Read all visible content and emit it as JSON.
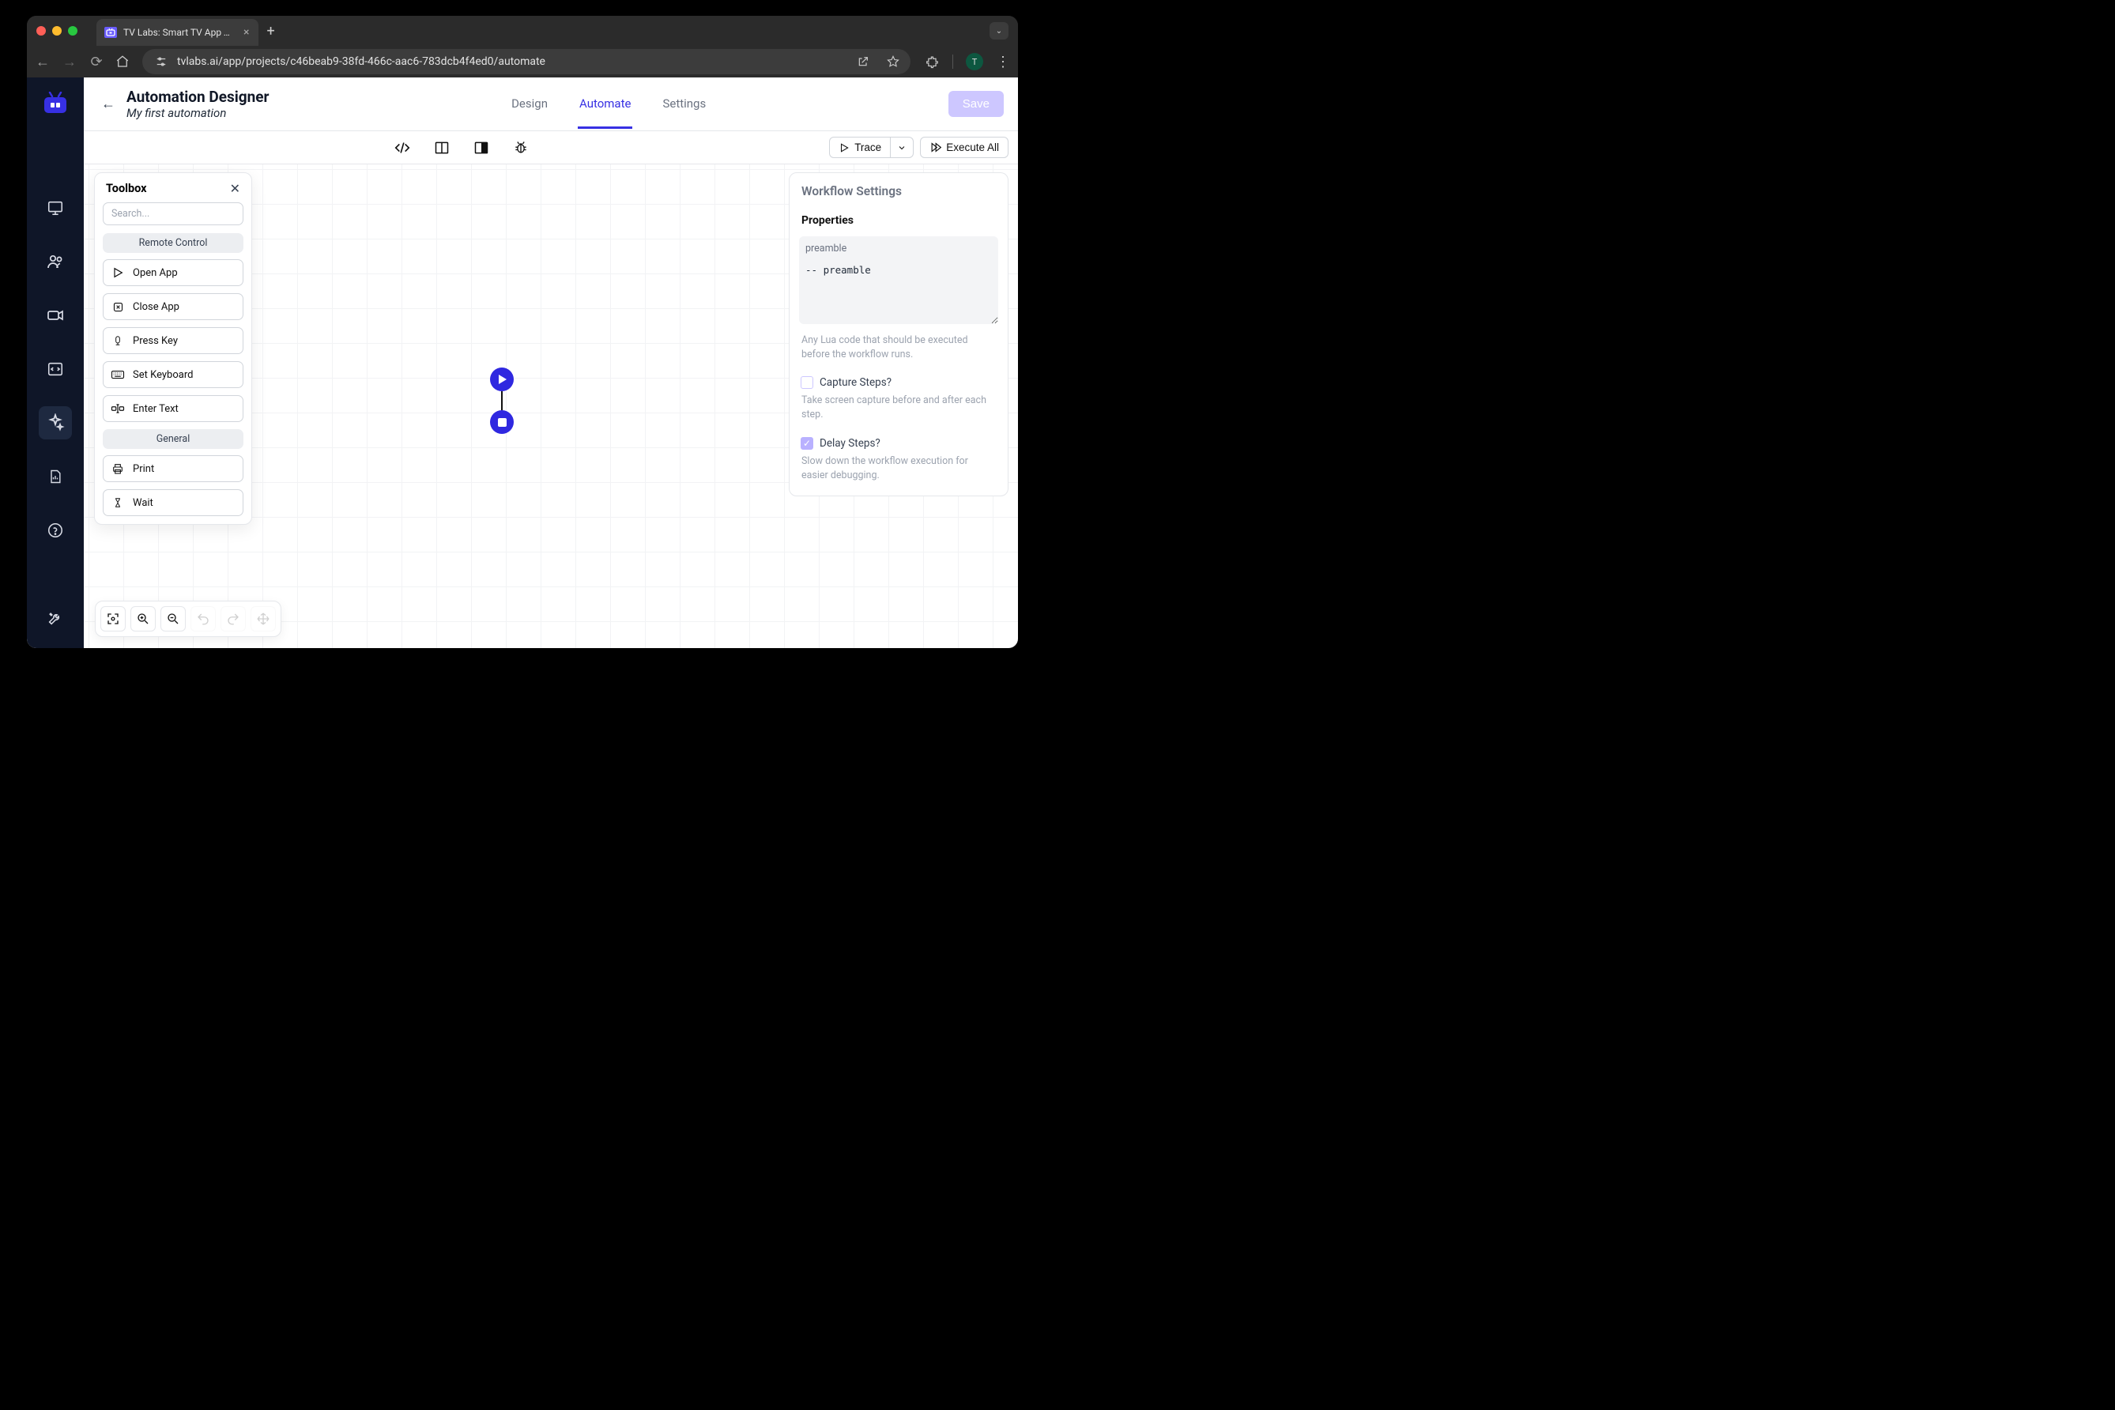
{
  "browser": {
    "tab_title": "TV Labs: Smart TV App Testin",
    "url": "tvlabs.ai/app/projects/c46beab9-38fd-466c-aac6-783dcb4f4ed0/automate",
    "avatar_initial": "T"
  },
  "header": {
    "title": "Automation Designer",
    "subtitle": "My first automation",
    "tabs": {
      "design": "Design",
      "automate": "Automate",
      "settings": "Settings"
    },
    "save_label": "Save"
  },
  "subtoolbar": {
    "trace_label": "Trace",
    "execute_all_label": "Execute All"
  },
  "toolbox": {
    "title": "Toolbox",
    "search_placeholder": "Search...",
    "sections": {
      "remote_control": "Remote Control",
      "general": "General"
    },
    "items": {
      "open_app": "Open App",
      "close_app": "Close App",
      "press_key": "Press Key",
      "set_keyboard": "Set Keyboard",
      "enter_text": "Enter Text",
      "print": "Print",
      "wait": "Wait"
    }
  },
  "workflow_settings": {
    "title": "Workflow Settings",
    "properties_label": "Properties",
    "preamble_label": "preamble",
    "preamble_value": "-- preamble",
    "preamble_help": "Any Lua code that should be executed before the workflow runs.",
    "capture_steps_label": "Capture Steps?",
    "capture_steps_help": "Take screen capture before and after each step.",
    "delay_steps_label": "Delay Steps?",
    "delay_steps_help": "Slow down the workflow execution for easier debugging."
  }
}
